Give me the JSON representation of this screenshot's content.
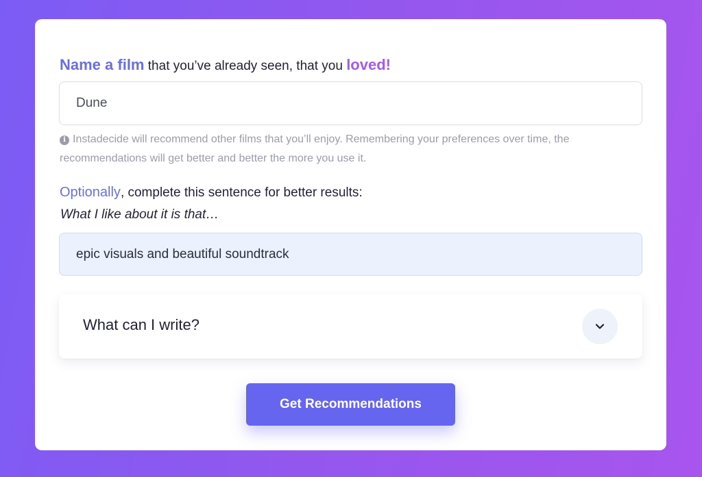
{
  "form": {
    "film_label": {
      "part1": "Name a film",
      "part2": " that you’ve already seen, that you ",
      "part3": "loved!"
    },
    "film_input": {
      "value": "Dune",
      "placeholder": ""
    },
    "hint": {
      "icon": "info-icon",
      "icon_glyph": "i",
      "text": "Instadecide will recommend other films that you’ll enjoy. Remembering your preferences over time, the recommendations will get better and better the more you use it."
    },
    "optional_label": {
      "part1": "Optionally",
      "part2": ", complete this sentence for better results:"
    },
    "sentence_prompt": "What I like about it is that…",
    "reason_input": {
      "value": "epic visuals and beautiful soundtrack",
      "placeholder": ""
    },
    "accordion": {
      "title": "What can I write?",
      "icon": "chevron-down-icon"
    },
    "submit_label": "Get Recommendations"
  },
  "colors": {
    "accent_blue": "#6a6fe0",
    "accent_purple": "#a35be8",
    "button": "#6565ef",
    "input_fill": "#ebf1fd"
  }
}
